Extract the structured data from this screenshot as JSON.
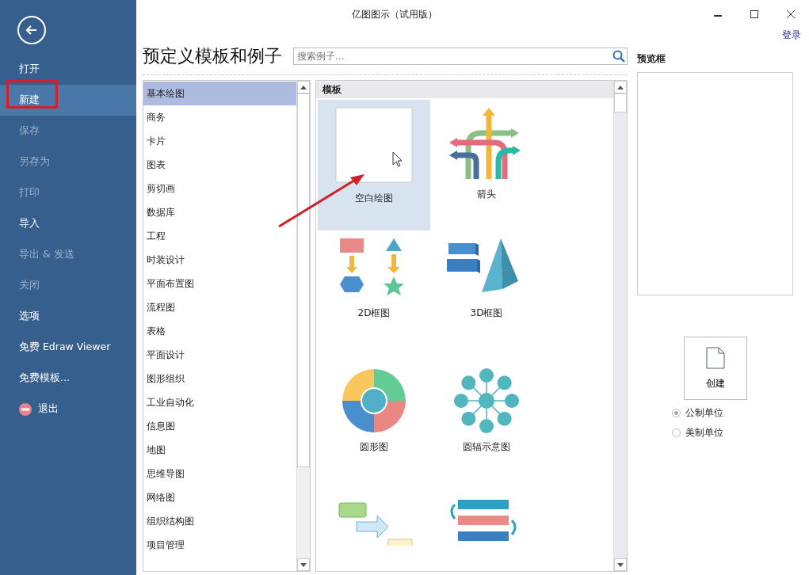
{
  "window": {
    "title": "亿图图示（试用版）",
    "login": "登录"
  },
  "sidebar": {
    "items": [
      {
        "label": "打开",
        "kind": "item",
        "selected": false,
        "disabled": false
      },
      {
        "label": "新建",
        "kind": "item",
        "selected": true,
        "disabled": false
      },
      {
        "label": "保存",
        "kind": "item",
        "selected": false,
        "disabled": true
      },
      {
        "label": "另存为",
        "kind": "item",
        "selected": false,
        "disabled": true
      },
      {
        "label": "打印",
        "kind": "item",
        "selected": false,
        "disabled": true
      },
      {
        "label": "导入",
        "kind": "item",
        "selected": false,
        "disabled": false
      },
      {
        "label": "导出 & 发送",
        "kind": "item",
        "selected": false,
        "disabled": true
      },
      {
        "label": "关闭",
        "kind": "item",
        "selected": false,
        "disabled": true
      },
      {
        "label": "选项",
        "kind": "item",
        "selected": false,
        "disabled": false
      },
      {
        "label": "免费 Edraw Viewer",
        "kind": "item",
        "selected": false,
        "disabled": false
      },
      {
        "label": "免费模板...",
        "kind": "item",
        "selected": false,
        "disabled": false
      },
      {
        "label": "退出",
        "kind": "exit",
        "selected": false,
        "disabled": false
      }
    ]
  },
  "heading": "预定义模板和例子",
  "search": {
    "placeholder": "搜索例子..."
  },
  "categories": [
    {
      "label": "基本绘图",
      "selected": true
    },
    {
      "label": "商务",
      "selected": false
    },
    {
      "label": "卡片",
      "selected": false
    },
    {
      "label": "图表",
      "selected": false
    },
    {
      "label": "剪切画",
      "selected": false
    },
    {
      "label": "数据库",
      "selected": false
    },
    {
      "label": "工程",
      "selected": false
    },
    {
      "label": "时装设计",
      "selected": false
    },
    {
      "label": "平面布置图",
      "selected": false
    },
    {
      "label": "流程图",
      "selected": false
    },
    {
      "label": "表格",
      "selected": false
    },
    {
      "label": "平面设计",
      "selected": false
    },
    {
      "label": "图形组织",
      "selected": false
    },
    {
      "label": "工业自动化",
      "selected": false
    },
    {
      "label": "信息图",
      "selected": false
    },
    {
      "label": "地图",
      "selected": false
    },
    {
      "label": "思维导图",
      "selected": false
    },
    {
      "label": "网络图",
      "selected": false
    },
    {
      "label": "组织结构图",
      "selected": false
    },
    {
      "label": "项目管理",
      "selected": false
    }
  ],
  "templates": {
    "header": "模板",
    "items": [
      {
        "label": "空白绘图",
        "kind": "blank",
        "selected": true
      },
      {
        "label": "箭头",
        "kind": "arrows",
        "selected": false
      },
      {
        "label": "2D框图",
        "kind": "block2d",
        "selected": false
      },
      {
        "label": "3D框图",
        "kind": "block3d",
        "selected": false
      },
      {
        "label": "圆形图",
        "kind": "circle",
        "selected": false
      },
      {
        "label": "圆辐示意图",
        "kind": "radial",
        "selected": false
      },
      {
        "kind": "flow",
        "selected": false
      },
      {
        "kind": "cycle",
        "selected": false
      }
    ]
  },
  "preview": {
    "title": "预览框",
    "create": "创建",
    "units": [
      {
        "label": "公制单位",
        "selected": true
      },
      {
        "label": "美制单位",
        "selected": false
      }
    ]
  }
}
